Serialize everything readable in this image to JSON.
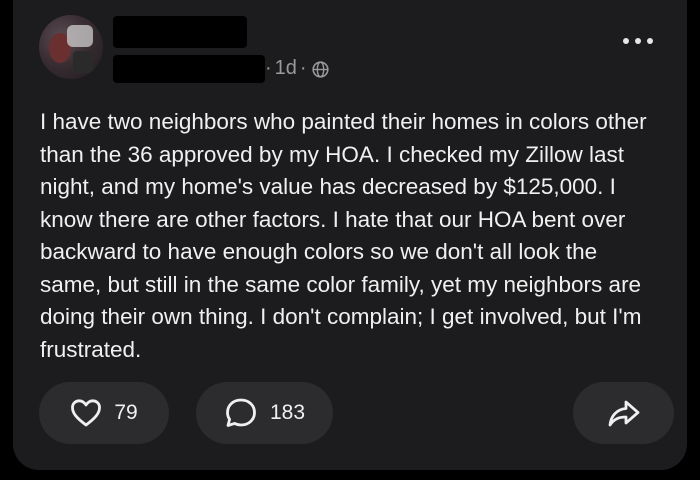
{
  "post": {
    "timestamp": "1d",
    "meta_separator": "·",
    "visibility_icon": "globe-icon",
    "text": "I have two neighbors who painted their homes in colors other than the 36 approved by my HOA. I checked my Zillow last night, and my home's value has decreased by $125,000. I know there are other factors. I hate that our HOA bent over backward to have enough colors so we don't all look the same, but still in the same color family, yet my neighbors are doing their own thing. I don't complain; I get involved, but I'm frustrated."
  },
  "actions": {
    "like_count": "79",
    "like_icon": "heart-icon",
    "comment_count": "183",
    "comment_icon": "speech-bubble-icon",
    "share_icon": "share-arrow-icon"
  },
  "colors": {
    "background": "#000000",
    "card": "#1c1c1e",
    "pill": "#2c2c2e",
    "text": "#f0f0f0",
    "muted": "#9a9a9e"
  }
}
